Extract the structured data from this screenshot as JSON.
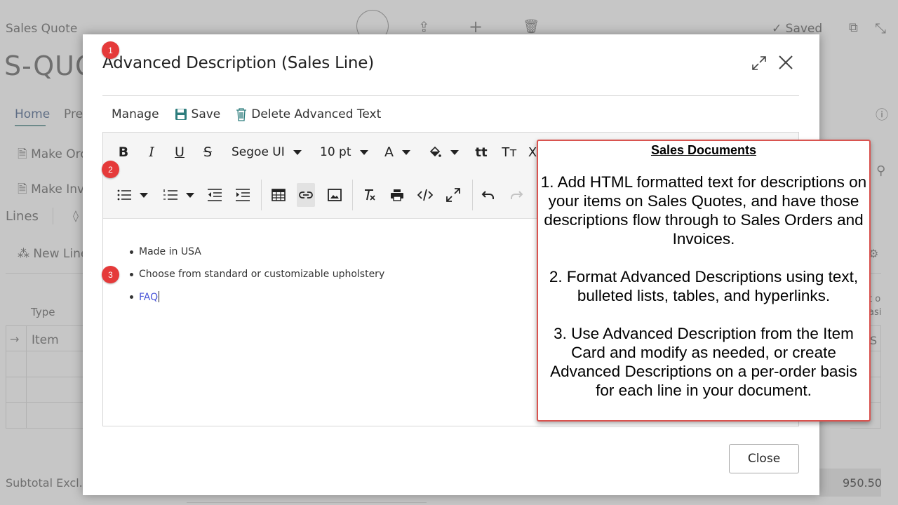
{
  "background": {
    "breadcrumb": "Sales Quote",
    "doc_number": "S-QUO",
    "saved_label": "Saved",
    "tabs": [
      "Home",
      "Prep"
    ],
    "actions": [
      "Make Ord",
      "Make Inv"
    ],
    "lines_label": "Lines",
    "new_line": "New Line",
    "type_header": "Type",
    "row_value": "Item",
    "subtotal_label": "Subtotal Excl. T",
    "subtotal_value": "950.50",
    "partial_right_1": "t o",
    "partial_right_2": "asi",
    "partial_right_3": "S"
  },
  "dialog": {
    "title": "Advanced Description (Sales Line)",
    "actions": {
      "manage": "Manage",
      "save": "Save",
      "delete": "Delete Advanced Text"
    },
    "toolbar": {
      "font_family": "Segoe UI",
      "font_size": "10 pt"
    },
    "content": {
      "items": [
        "Made in USA",
        "Choose from standard or customizable upholstery",
        "FAQ"
      ]
    },
    "close_label": "Close"
  },
  "markers": [
    "1",
    "2",
    "3"
  ],
  "callout": {
    "title": "Sales Documents",
    "p1": "1. Add HTML formatted text for descriptions on your items on Sales Quotes, and have those descriptions flow through to Sales Orders and Invoices.",
    "p2": "2. Format Advanced Descriptions using text, bulleted lists, tables, and hyperlinks.",
    "p3": "3. Use Advanced Description from the Item Card and modify as needed, or create Advanced Descriptions on a per-order basis for each line in your document."
  },
  "colors": {
    "marker_red": "#e53a3a",
    "callout_border": "#d9534f",
    "link_blue": "#4a55d8",
    "save_teal": "#2e7d7d"
  }
}
